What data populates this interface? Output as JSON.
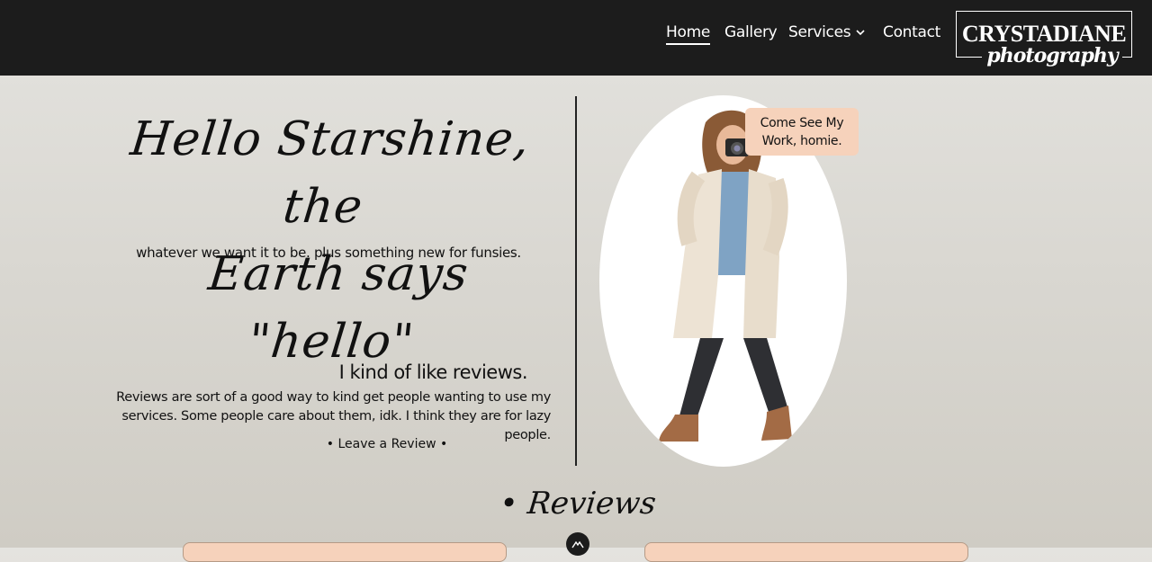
{
  "header": {
    "nav": [
      "Home",
      "Gallery",
      "Services",
      "Contact"
    ],
    "logo": {
      "main": "CRYSTADIANE",
      "sub": "photography"
    }
  },
  "hero": {
    "title_line1": "Hello Starshine, the",
    "title_line2": "Earth says \"hello\"",
    "subtitle": "whatever we want it to be. plus something new for funsies."
  },
  "reviews_teaser": {
    "heading": "I kind of like reviews.",
    "body": "Reviews are sort of a good way to kind get people wanting to use my services. Some people care about them, idk. I think they are for lazy people.",
    "link": "• Leave a Review •"
  },
  "photo": {
    "bubble": "Come See My Work, homie."
  },
  "reviews": {
    "heading": "• Reviews •"
  },
  "colors": {
    "header_bg": "#1c1c1c",
    "accent": "#f6d2bb"
  }
}
